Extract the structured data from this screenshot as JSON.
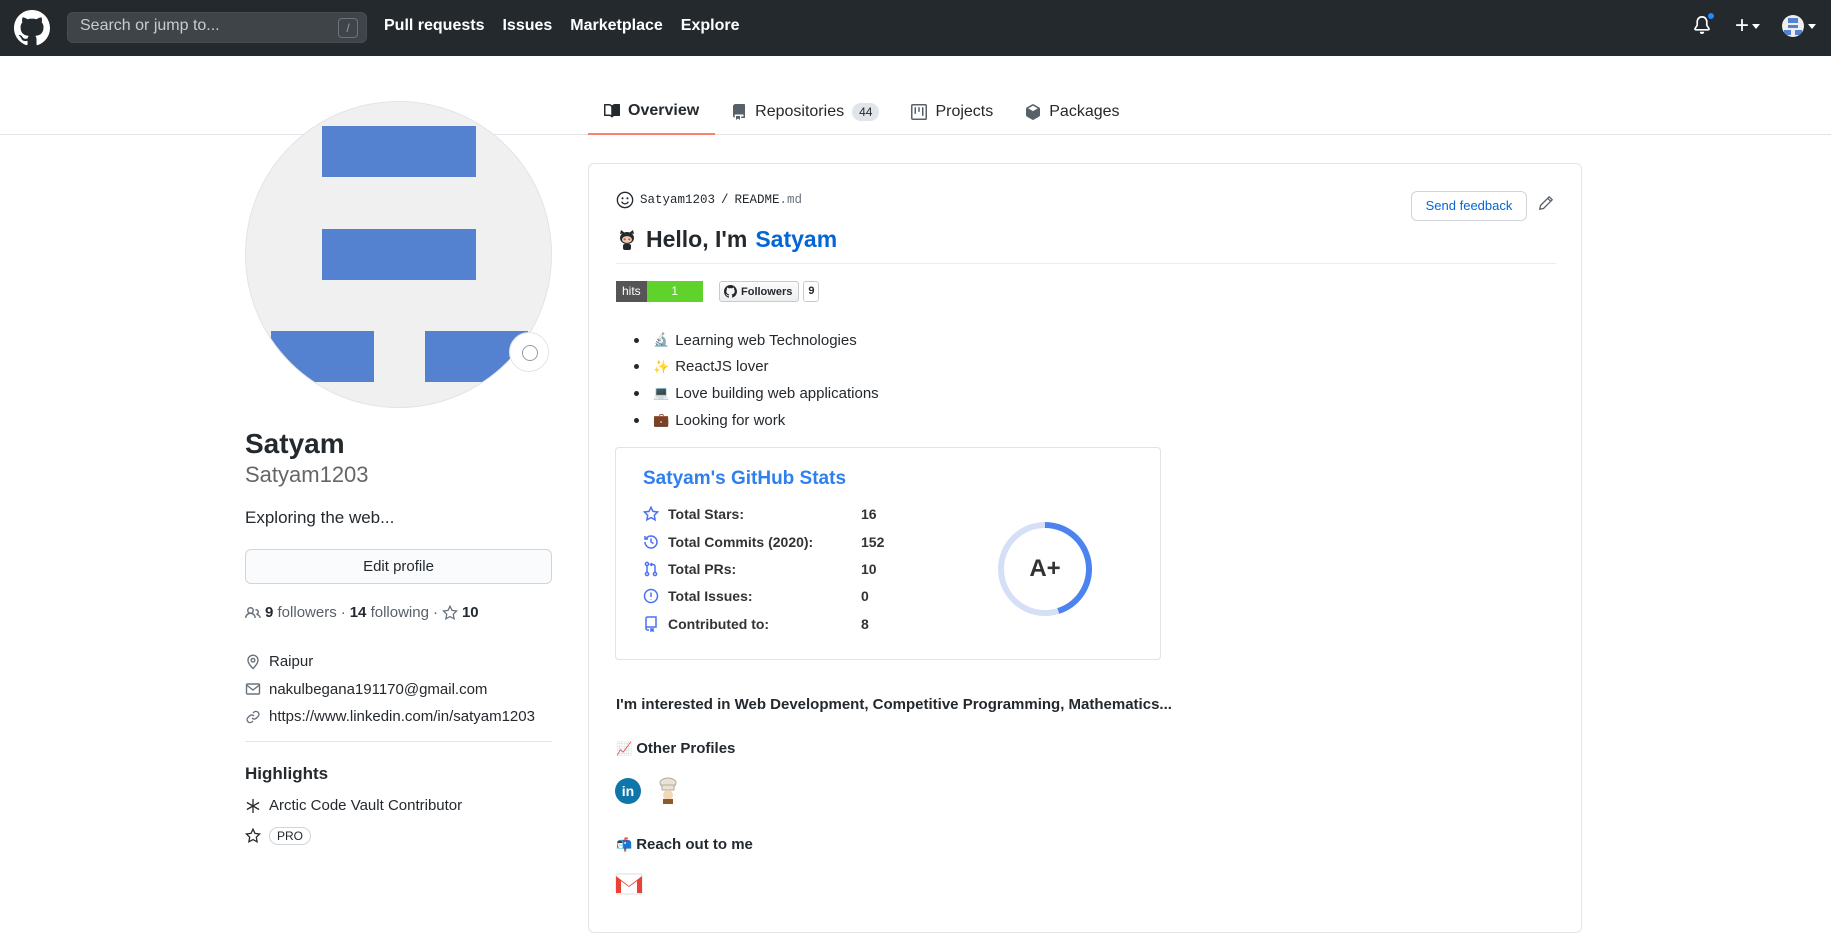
{
  "header": {
    "search_placeholder": "Search or jump to...",
    "search_key": "/",
    "nav": [
      "Pull requests",
      "Issues",
      "Marketplace",
      "Explore"
    ],
    "plus": "+"
  },
  "tabs": [
    {
      "label": "Overview",
      "icon": "book-icon",
      "active": true
    },
    {
      "label": "Repositories",
      "icon": "repo-icon",
      "count": "44"
    },
    {
      "label": "Projects",
      "icon": "project-icon"
    },
    {
      "label": "Packages",
      "icon": "package-icon"
    }
  ],
  "profile": {
    "name": "Satyam",
    "username": "Satyam1203",
    "bio": "Exploring the web...",
    "edit_button": "Edit profile",
    "followers_count": "9",
    "followers_label": "followers",
    "sep1": "·",
    "following_count": "14",
    "following_label": "following",
    "sep2": "·",
    "stars_count": "10",
    "location": "Raipur",
    "email": "nakulbegana191170@gmail.com",
    "website": "https://www.linkedin.com/in/satyam1203",
    "highlights_title": "Highlights",
    "highlight_1": "Arctic Code Vault Contributor",
    "pro_badge": "PRO"
  },
  "readme": {
    "path_user": "Satyam1203",
    "path_sep": "/",
    "path_file": "README",
    "path_ext": ".md",
    "send_feedback": "Send feedback",
    "heading_prefix": "Hello, I'm",
    "heading_name": "Satyam",
    "hits_label": "hits",
    "hits_value": "1",
    "followers_badge_label": "Followers",
    "followers_badge_value": "9",
    "bullets": [
      {
        "emoji": "🔬",
        "text": "Learning web Technologies"
      },
      {
        "emoji": "✨",
        "text": "ReactJS lover"
      },
      {
        "emoji": "💻",
        "text": "Love building web applications"
      },
      {
        "emoji": "💼",
        "text": "Looking for work"
      }
    ],
    "stats": {
      "title": "Satyam's GitHub Stats",
      "rows": [
        {
          "label": "Total Stars:",
          "value": "16"
        },
        {
          "label": "Total Commits (2020):",
          "value": "152"
        },
        {
          "label": "Total PRs:",
          "value": "10"
        },
        {
          "label": "Total Issues:",
          "value": "0"
        },
        {
          "label": "Contributed to:",
          "value": "8"
        }
      ],
      "rank": "A+",
      "rank_progress": 0.45
    },
    "interest": "I'm interested in Web Development, Competitive Programming, Mathematics...",
    "other_profiles": "Other Profiles",
    "other_profiles_emoji": "📈",
    "reach_out": "Reach out to me",
    "reach_out_emoji": "📬",
    "linkedin_letter": "in"
  },
  "colors": {
    "header_bg": "#24292e",
    "link": "#0366d6",
    "tab_underline": "#f9826c",
    "stats_title": "#2f80ed",
    "stats_icon": "#4c71f2",
    "hits_green": "#5fd32b"
  }
}
